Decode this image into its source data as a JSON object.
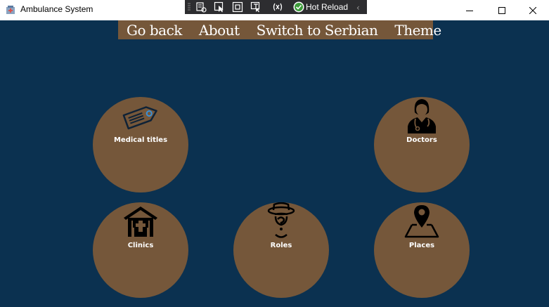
{
  "window": {
    "title": "Ambulance System"
  },
  "debug_toolbar": {
    "hot_reload_label": "Hot Reload"
  },
  "menu": {
    "items": [
      "Go back",
      "About",
      "Switch to Serbian",
      "Theme"
    ]
  },
  "tiles": [
    {
      "label": "Medical titles",
      "icon": "tag-icon"
    },
    {
      "label": "Doctors",
      "icon": "doctor-icon"
    },
    {
      "label": "Clinics",
      "icon": "hospital-icon"
    },
    {
      "label": "Roles",
      "icon": "detective-icon"
    },
    {
      "label": "Places",
      "icon": "map-pin-icon"
    }
  ],
  "colors": {
    "background": "#0b3150",
    "tile": "#75573a",
    "menu": "#75573a"
  }
}
